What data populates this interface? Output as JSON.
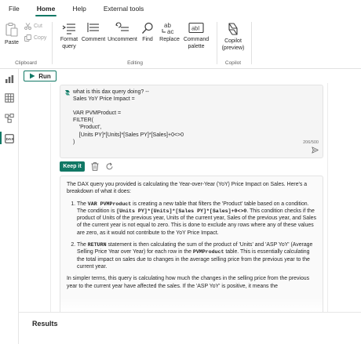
{
  "menu": {
    "items": [
      {
        "label": "File"
      },
      {
        "label": "Home"
      },
      {
        "label": "Help"
      },
      {
        "label": "External tools"
      }
    ]
  },
  "ribbon": {
    "clipboard": {
      "label": "Clipboard",
      "paste": "Paste",
      "cut": "Cut",
      "copy": "Copy"
    },
    "editing": {
      "label": "Editing",
      "format_query": "Format query",
      "comment": "Comment",
      "uncomment": "Uncomment",
      "find": "Find",
      "replace": "Replace",
      "command_palette": "Command palette"
    },
    "copilot": {
      "label": "Copilot",
      "button": "Copilot (preview)"
    }
  },
  "toolbar": {
    "run_label": "Run"
  },
  "prompt": {
    "lines": [
      "what is this dax query doing? --",
      "Sales YoY Price Impact =",
      "",
      "VAR PVMProduct =",
      "FILTER(",
      "    'Product',",
      "    [Units PY]*[Units]*[Sales PY]*[Sales]+0<>0",
      ")"
    ],
    "char_count": "206/500"
  },
  "actions": {
    "keep_label": "Keep it"
  },
  "answer": {
    "intro": "The DAX query you provided is calculating the Year-over-Year (YoY) Price Impact on Sales. Here's a breakdown of what it does:",
    "item1": {
      "a": "The ",
      "code1": "VAR PVMProduct",
      "b": " is creating a new table that filters the 'Product' table based on a condition. The condition is ",
      "code2": "[Units PY]*[Units]*[Sales PY]*[Sales]+0<>0",
      "c": ". This condition checks if the product of Units of the previous year, Units of the current year, Sales of the previous year, and Sales of the current year is not equal to zero. This is done to exclude any rows where any of these values are zero, as it would not contribute to the YoY Price Impact."
    },
    "item2": {
      "a": "The ",
      "code1": "RETURN",
      "b": " statement is then calculating the sum of the product of 'Units' and 'ASP YoY' (Average Selling Price Year over Year) for each row in the ",
      "code2": "PVMProduct",
      "c": " table. This is essentially calculating the total impact on sales due to changes in the average selling price from the previous year to the current year."
    },
    "outro": "In simpler terms, this query is calculating how much the changes in the selling price from the previous year to the current year have affected the sales. If the 'ASP YoY' is positive, it means the"
  },
  "results": {
    "title": "Results"
  },
  "colors": {
    "accent": "#117865",
    "icon": "#3b3b3b",
    "disabled": "#a0a0a0"
  }
}
